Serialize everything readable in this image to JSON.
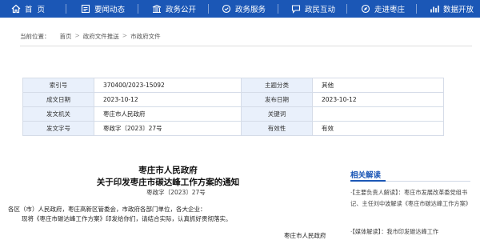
{
  "nav": [
    {
      "label": "首  页",
      "icon": "home-icon"
    },
    {
      "label": "要闻动态",
      "icon": "news-icon"
    },
    {
      "label": "政务公开",
      "icon": "open-gov-icon"
    },
    {
      "label": "政务服务",
      "icon": "service-icon"
    },
    {
      "label": "政民互动",
      "icon": "interaction-icon"
    },
    {
      "label": "走进枣庄",
      "icon": "city-icon"
    },
    {
      "label": "数据开放",
      "icon": "data-icon"
    }
  ],
  "breadcrumb": {
    "prefix": "当前位置：",
    "items": [
      "首页",
      "政府文件推送",
      "市政府文件"
    ],
    "separator": ">"
  },
  "info": {
    "index_label": "索引号",
    "index_value": "370400/2023-15092",
    "topic_label": "主题分类",
    "topic_value": "其他",
    "date_label": "成文日期",
    "date_value": "2023-10-12",
    "pub_label": "发布日期",
    "pub_value": "2023-10-12",
    "org_label": "发文机关",
    "org_value": "枣庄市人民政府",
    "kw_label": "关键词",
    "kw_value": "",
    "num_label": "发文字号",
    "num_value": "枣政字〔2023〕27号",
    "valid_label": "有效性",
    "valid_value": "有效"
  },
  "doc": {
    "title1": "枣庄市人民政府",
    "title2": "关于印发枣庄市碳达峰工作方案的通知",
    "number": "枣政字〔2023〕27号",
    "para1": "各区（市）人民政府，枣庄高新区管委会，市政府各部门单位，各大企业：",
    "para2": "现将《枣庄市碳达峰工作方案》印发给你们，请结合实际，认真抓好贯彻落实。",
    "signature": "枣庄市人民政府"
  },
  "related": {
    "title": "相关解读",
    "items": [
      "·【主要负责人解读】：枣庄市发展改革委党组书记、主任刘中波解读《枣庄市碳达峰工作方案》",
      "·【媒体解读】：我市印发碳达峰工作"
    ]
  }
}
